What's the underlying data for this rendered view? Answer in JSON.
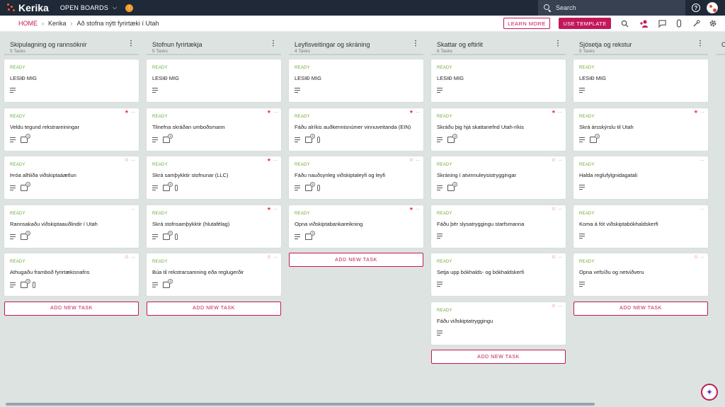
{
  "topbar": {
    "logo": "Kerika",
    "open_boards": "OPEN BOARDS",
    "search_placeholder": "Search"
  },
  "breadcrumb": {
    "home": "HOME",
    "org": "Kerika",
    "board": "Að stofna nýtt fyrirtæki í Utah"
  },
  "actions": {
    "learn_more": "LEARN MORE",
    "use_template": "USE TEMPLATE"
  },
  "add_task_label": "ADD NEW TASK",
  "columns": [
    {
      "title": "Skipulagning og rannsóknir",
      "count": "5 Tasks",
      "cards": [
        {
          "status": "READY",
          "title": "LESIÐ MIG",
          "star": "",
          "checklist": "",
          "attach": false
        },
        {
          "status": "READY",
          "title": "Veldu tegund rekstrareiningar",
          "star": "filled",
          "checklist": "4",
          "attach": false
        },
        {
          "status": "READY",
          "title": "Þróa alhliða viðskiptaáætlun",
          "star": "outline",
          "checklist": "4",
          "attach": false
        },
        {
          "status": "READY",
          "title": "Rannsakaðu viðskiptaauðlindir í Utah",
          "star": "",
          "checklist": "3",
          "attach": false
        },
        {
          "status": "READY",
          "title": "Athugaðu framboð fyrirtækisnafns",
          "star": "outline",
          "checklist": "3",
          "attach": true
        }
      ]
    },
    {
      "title": "Stofnun fyrirtækja",
      "count": "5 Tasks",
      "cards": [
        {
          "status": "READY",
          "title": "LESIÐ MIG",
          "star": "",
          "checklist": "",
          "attach": false
        },
        {
          "status": "READY",
          "title": "Tilnefna skráðan umboðsmann",
          "star": "filled",
          "checklist": "4",
          "attach": false
        },
        {
          "status": "READY",
          "title": "Skrá samþykktir stofnunar (LLC)",
          "star": "filled",
          "checklist": "5",
          "attach": true
        },
        {
          "status": "READY",
          "title": "Skrá stofnsamþykktir (hlutafélag)",
          "star": "filled",
          "checklist": "5",
          "attach": true
        },
        {
          "status": "READY",
          "title": "Búa til rekstrarsamning eða reglugerðir",
          "star": "outline",
          "checklist": "4",
          "attach": false
        }
      ]
    },
    {
      "title": "Leyfisveitingar og skráning",
      "count": "4 Tasks",
      "cards": [
        {
          "status": "READY",
          "title": "LESIÐ MIG",
          "star": "",
          "checklist": "",
          "attach": false
        },
        {
          "status": "READY",
          "title": "Fáðu alríkis auðkennisnúmer vinnuveitanda (EIN)",
          "star": "filled",
          "checklist": "4",
          "attach": true
        },
        {
          "status": "READY",
          "title": "Fáðu nauðsynleg viðskiptaleyfi og leyfi",
          "star": "outline",
          "checklist": "5",
          "attach": true
        },
        {
          "status": "READY",
          "title": "Opna viðskiptabankareikning",
          "star": "filled",
          "checklist": "4",
          "attach": false
        }
      ]
    },
    {
      "title": "Skattar og eftirlit",
      "count": "6 Tasks",
      "cards": [
        {
          "status": "READY",
          "title": "LESIÐ MIG",
          "star": "",
          "checklist": "",
          "attach": false
        },
        {
          "status": "READY",
          "title": "Skráðu þig hjá skattanefnd Utah-ríkis",
          "star": "filled",
          "checklist": "4",
          "attach": false
        },
        {
          "status": "READY",
          "title": "Skráning í atvinnuleysistryggingar",
          "star": "outline",
          "checklist": "4",
          "attach": false
        },
        {
          "status": "READY",
          "title": "Fáðu þér slysatryggingu starfsmanna",
          "star": "outline",
          "checklist": "",
          "attach": false
        },
        {
          "status": "READY",
          "title": "Setja upp bókhalds- og bókhaldskerfi",
          "star": "outline",
          "checklist": "",
          "attach": false
        },
        {
          "status": "READY",
          "title": "Fáðu viðskiptatryggingu",
          "star": "outline",
          "checklist": "",
          "attach": false
        }
      ]
    },
    {
      "title": "Sjósetja og rekstur",
      "count": "5 Tasks",
      "cards": [
        {
          "status": "READY",
          "title": "LESIÐ MIG",
          "star": "",
          "checklist": "",
          "attach": false
        },
        {
          "status": "READY",
          "title": "Skrá ársskýrslu til Utah",
          "star": "filled",
          "checklist": "4",
          "attach": false
        },
        {
          "status": "READY",
          "title": "Halda reglufylgnidagatali",
          "star": "",
          "checklist": "",
          "attach": false
        },
        {
          "status": "READY",
          "title": "Koma á fót viðskiptabókhaldskerfi",
          "star": "",
          "checklist": "",
          "attach": false
        },
        {
          "status": "READY",
          "title": "Opna vefsíðu og netviðveru",
          "star": "outline",
          "checklist": "",
          "attach": false
        }
      ]
    }
  ],
  "partial_column_initial": "O",
  "colors": {
    "accent": "#c2185b",
    "ready": "#6bab30",
    "star": "#e53935",
    "topbar": "#1f2937"
  }
}
